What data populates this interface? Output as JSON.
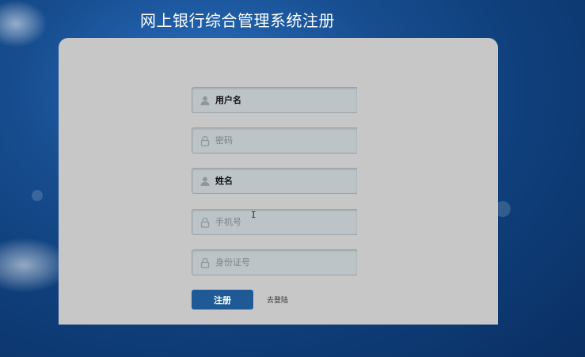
{
  "page_title": "网上银行综合管理系统注册",
  "form": {
    "username_placeholder": "用户名",
    "password_placeholder": "密码",
    "name_placeholder": "姓名",
    "phone_placeholder": "手机号",
    "idcard_placeholder": "身份证号"
  },
  "actions": {
    "register_label": "注册",
    "login_link_label": "去登陆"
  },
  "colors": {
    "background": "#174d8f",
    "card": "#c7c7c7",
    "field": "#bcc4c8",
    "button": "#1f5a97"
  },
  "icons": {
    "username": "user-icon",
    "password": "lock-icon",
    "name": "user-icon",
    "phone": "lock-icon",
    "idcard": "lock-icon"
  }
}
